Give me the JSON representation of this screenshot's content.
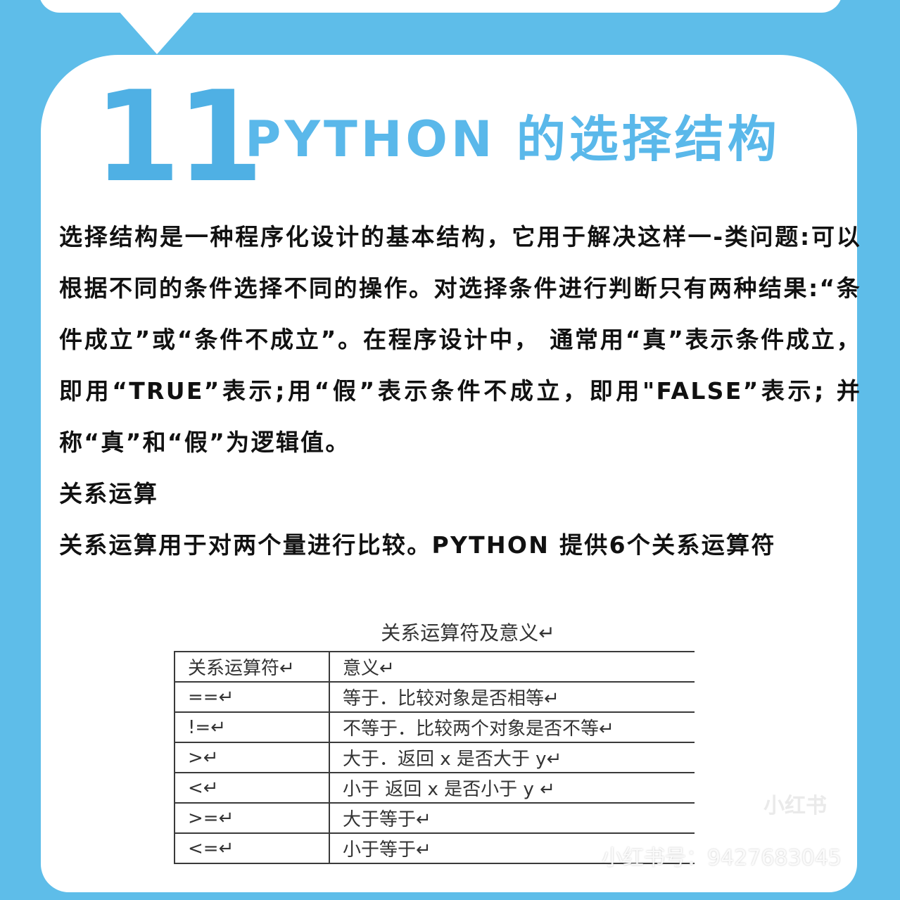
{
  "title": {
    "number": "11",
    "text": "PYTHON 的选择结构"
  },
  "body": {
    "paragraph": "选择结构是一种程序化设计的基本结构，它用于解决这样一-类问题:可以根据不同的条件选择不同的操作。对选择条件进行判断只有两种结果:“条件成立”或“条件不成立”。在程序设计中， 通常用“真”表示条件成立，即用“TRUE”表示;用“假”表示条件不成立，即用\"FALSE”表示; 并称“真”和“假”为逻辑值。",
    "section_heading": "关系运算",
    "section_text": "关系运算用于对两个量进行比较。PYTHON 提供6个关系运算符"
  },
  "table": {
    "caption": "关系运算符及意义↵",
    "headers": [
      "关系运算符↵",
      "意义↵"
    ],
    "rows": [
      [
        "==↵",
        "等于．比较对象是否相等↵"
      ],
      [
        "!=↵",
        "不等于．比较两个对象是否不等↵"
      ],
      [
        ">↵",
        "大于．返回 x 是否大于 y↵"
      ],
      [
        "<↵",
        "小于 返回 x 是否小于 y ↵"
      ],
      [
        ">=↵",
        "大于等于↵"
      ],
      [
        "<=↵",
        "小于等于↵"
      ]
    ]
  },
  "watermark": {
    "text": "小红书号：9427683045",
    "logo": "小红书"
  },
  "colors": {
    "background": "#5ebde9",
    "title": "#5ab8ea",
    "card": "#ffffff"
  }
}
